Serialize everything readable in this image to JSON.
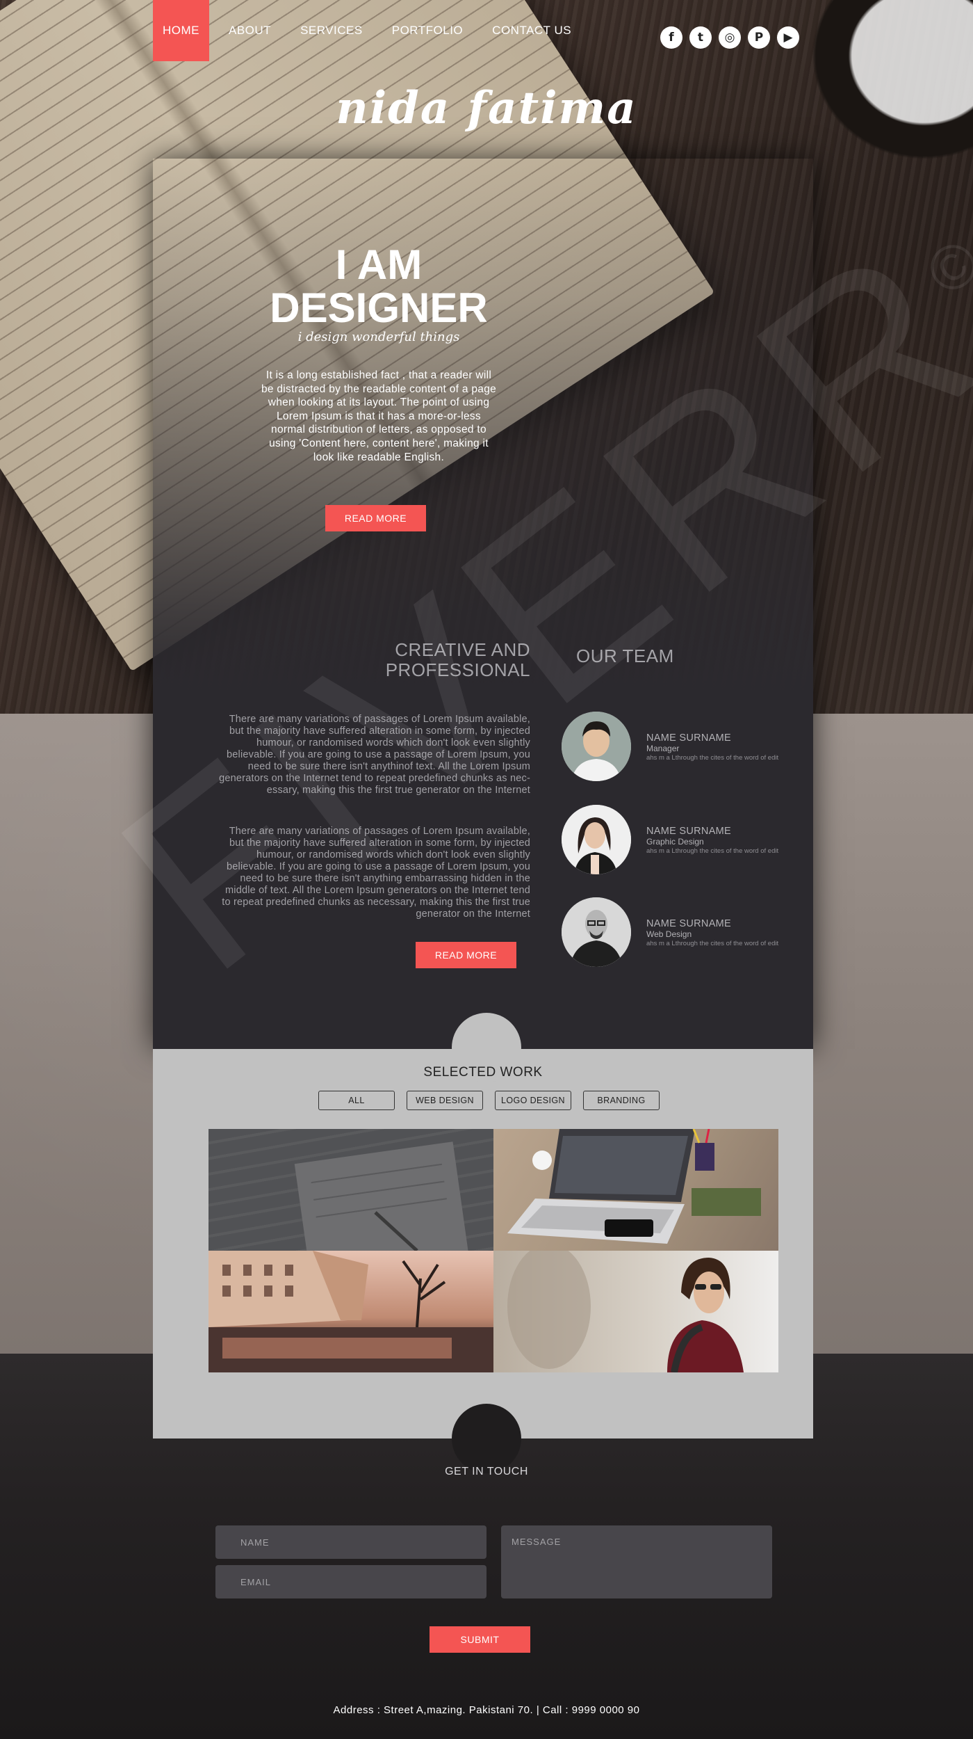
{
  "nav": {
    "items": [
      {
        "label": "HOME",
        "active": true
      },
      {
        "label": "ABOUT"
      },
      {
        "label": "SERVICES"
      },
      {
        "label": "PORTFOLIO"
      },
      {
        "label": "CONTACT US"
      }
    ],
    "social": [
      {
        "icon": "facebook-icon",
        "glyph": "f"
      },
      {
        "icon": "twitter-icon",
        "glyph": "t"
      },
      {
        "icon": "instagram-icon",
        "glyph": "◎"
      },
      {
        "icon": "pinterest-icon",
        "glyph": "P"
      },
      {
        "icon": "youtube-icon",
        "glyph": "▶"
      }
    ]
  },
  "logo": "nida fatima",
  "hero": {
    "title_line1": "I AM",
    "title_line2": "DESIGNER",
    "tagline": "i design wonderful things",
    "text": "It is a long established fact , that a reader will be distracted by the readable content of a page when looking at its layout. The point of using Lorem Ipsum is that it has a more-or-less normal distribution of letters, as opposed to using 'Content here, content here', making it look like readable English.",
    "button": "READ MORE"
  },
  "about": {
    "heading_line1": "CREATIVE AND",
    "heading_line2": "PROFESSIONAL",
    "paragraph1": "There are many variations of passages of Lorem Ipsum available, but the majority have suffered alteration in some form, by injected humour, or randomised words which don't look even slightly believable. If you are going to use a passage of Lorem Ipsum, you need to be sure there isn't anythinof text. All the Lorem Ipsum generators on the Internet tend to repeat predefined chunks as nec-essary, making this the first true generator on the Internet",
    "paragraph2": "There are many variations of passages of Lorem Ipsum available, but the majority have suffered alteration in some form, by injected humour, or randomised words which don't look even slightly believable. If you are going to use a passage of Lorem Ipsum, you need to be sure there isn't anything embarrassing hidden in the middle of text. All the Lorem Ipsum generators on the Internet tend to repeat predefined chunks as necessary, making this the first true generator on the Internet",
    "button": "READ MORE"
  },
  "team": {
    "heading": "OUR TEAM",
    "members": [
      {
        "name": "NAME SURNAME",
        "role": "Manager",
        "desc": "ahs m a Lthrough the cites of the word of edit"
      },
      {
        "name": "NAME SURNAME",
        "role": "Graphic Design",
        "desc": "ahs m a Lthrough the cites of the word of edit"
      },
      {
        "name": "NAME SURNAME",
        "role": "Web Design",
        "desc": "ahs m a Lthrough the cites of the word of edit"
      }
    ]
  },
  "work": {
    "title": "SELECTED WORK",
    "filters": [
      "ALL",
      "WEB DESIGN",
      "LOGO DESIGN",
      "BRANDING"
    ]
  },
  "contact": {
    "title": "GET IN TOUCH",
    "name_placeholder": "NAME",
    "email_placeholder": "EMAIL",
    "message_placeholder": "MESSAGE",
    "submit": "SUBMIT"
  },
  "footer": "Address : Street A,mazing. Pakistani 70.   |   Call : 9999 0000 90",
  "watermark": "FIVERR",
  "watermark_mark": "©",
  "colors": {
    "accent": "#f45553",
    "panel": "#2b292e",
    "work_bg": "#c1c1c1"
  }
}
